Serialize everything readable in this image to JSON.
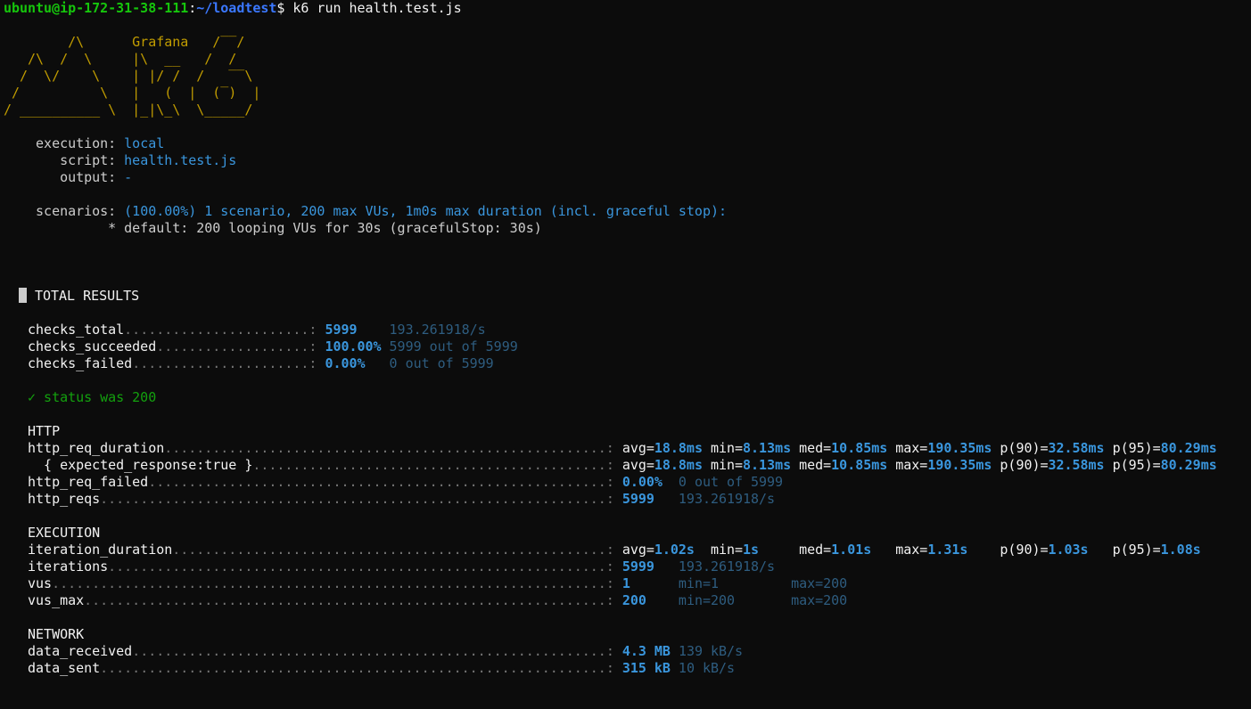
{
  "prompt": {
    "user_host": "ubuntu@ip-172-31-38-111",
    "colon": ":",
    "path": "~/loadtest",
    "symbol": "$",
    "command": " k6 run health.test.js"
  },
  "logo_lines": [
    "        /\\      Grafana   /‾‾/  ",
    "   /\\  /  \\     |\\  __   /  /   ",
    "  /  \\/    \\    | |/ /  /   ‾‾\\ ",
    " /          \\   |   (  |  (‾)  |",
    "/ __________ \\  |_|\\_\\  \\_____/ "
  ],
  "run_info": {
    "execution_label": "    execution: ",
    "execution_value": "local",
    "script_label": "       script: ",
    "script_value": "health.test.js",
    "output_label": "       output: ",
    "output_value": "-",
    "scenarios_label": "    scenarios: ",
    "scenarios_value": "(100.00%) 1 scenario, 200 max VUs, 1m0s max duration (incl. graceful stop):",
    "default_line": "             * default: 200 looping VUs for 30s (gracefulStop: 30s)"
  },
  "total_results": {
    "header": "TOTAL RESULTS",
    "checks": [
      {
        "name": "   checks_total",
        "dots": ".......................: ",
        "value": "5999   ",
        "extra": " 193.261918/s"
      },
      {
        "name": "   checks_succeeded",
        "dots": "...................: ",
        "value": "100.00%",
        "extra": " 5999 out of 5999"
      },
      {
        "name": "   checks_failed",
        "dots": "......................: ",
        "value": "0.00%  ",
        "extra": " 0 out of 5999"
      }
    ],
    "check_status": "   ✓ status was 200"
  },
  "http": {
    "header": "   HTTP",
    "metrics": [
      {
        "name": "   http_req_duration",
        "dots": ".......................................................: "
      },
      {
        "name": "     { expected_response:true }",
        "dots": "............................................: "
      }
    ],
    "duration_values": {
      "avg_label": "avg=",
      "avg": "18.8ms",
      "min_label": " min=",
      "min": "8.13ms",
      "med_label": " med=",
      "med": "10.85ms",
      "max_label": " max=",
      "max": "190.35ms",
      "p90_label": " p(90)=",
      "p90": "32.58ms",
      "p95_label": " p(95)=",
      "p95": "80.29ms"
    },
    "failed": {
      "name": "   http_req_failed",
      "dots": ".........................................................: ",
      "value": "0.00%",
      "extra": "  0 out of 5999"
    },
    "reqs": {
      "name": "   http_reqs",
      "dots": "...............................................................: ",
      "value": "5999",
      "extra": "   193.261918/s"
    }
  },
  "execution": {
    "header": "   EXECUTION",
    "iteration_duration": {
      "name": "   iteration_duration",
      "dots": "......................................................: ",
      "avg_label": "avg=",
      "avg": "1.02s",
      "min_label": "  min=",
      "min": "1s",
      "med_label": "     med=",
      "med": "1.01s",
      "max_label": "   max=",
      "max": "1.31s",
      "p90_label": "    p(90)=",
      "p90": "1.03s",
      "p95_label": "   p(95)=",
      "p95": "1.08s"
    },
    "iterations": {
      "name": "   iterations",
      "dots": "..............................................................: ",
      "value": "5999",
      "extra": "   193.261918/s"
    },
    "vus": {
      "name": "   vus",
      "dots": ".....................................................................: ",
      "value": "1",
      "extra": "      min=1         max=200"
    },
    "vus_max": {
      "name": "   vus_max",
      "dots": ".................................................................: ",
      "value": "200",
      "extra": "    min=200       max=200"
    }
  },
  "network": {
    "header": "   NETWORK",
    "received": {
      "name": "   data_received",
      "dots": "...........................................................: ",
      "value": "4.3 MB",
      "extra": " 139 kB/s"
    },
    "sent": {
      "name": "   data_sent",
      "dots": "...............................................................: ",
      "value": "315 kB",
      "extra": " 10 kB/s"
    }
  }
}
